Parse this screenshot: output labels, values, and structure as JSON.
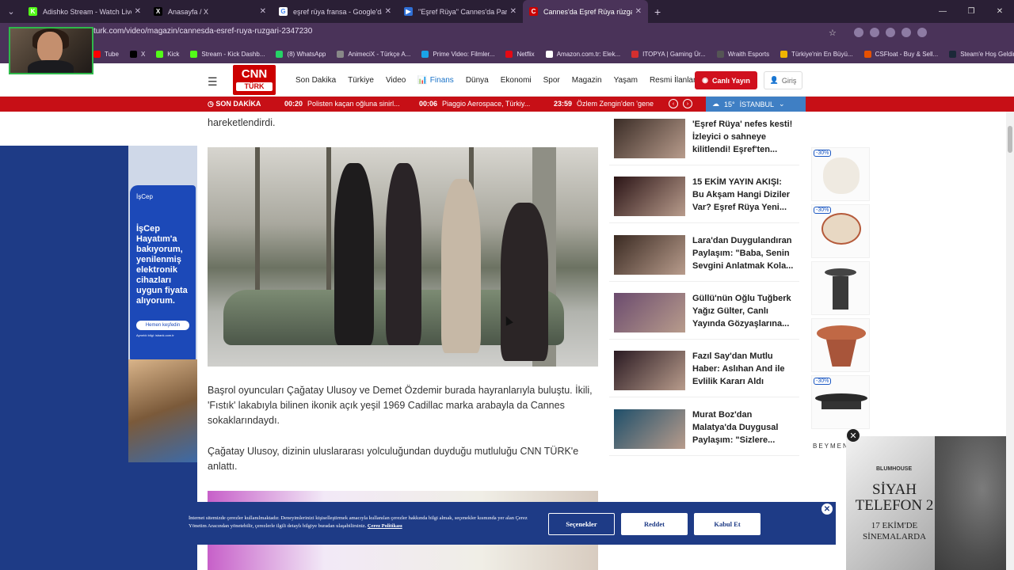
{
  "browser": {
    "tabs": [
      {
        "label": "Adishko Stream - Watch Live on",
        "color": "#53fc18",
        "glyph": "K"
      },
      {
        "label": "Anasayfa / X",
        "color": "#000000",
        "glyph": "X"
      },
      {
        "label": "eşref rüya fransa - Google'da A",
        "color": "#ffffff",
        "glyph": "G"
      },
      {
        "label": "\"Eşref Rüya\" Cannes'da Parladı",
        "color": "#2f6fd6",
        "glyph": "▶"
      },
      {
        "label": "Cannes'da Eşref Rüya rüzgarı",
        "color": "#cc0000",
        "glyph": "C"
      }
    ],
    "url": "turk.com/video/magazin/cannesda-esref-ruya-ruzgari-2347230",
    "bookmarks": [
      {
        "label": "Tube",
        "color": "#ff0000"
      },
      {
        "label": "X",
        "color": "#000000"
      },
      {
        "label": "Kick",
        "color": "#53fc18"
      },
      {
        "label": "Stream - Kick Dashb...",
        "color": "#53fc18"
      },
      {
        "label": "(8) WhatsApp",
        "color": "#25d366"
      },
      {
        "label": "AnimeciX - Türkçe A...",
        "color": "#888888"
      },
      {
        "label": "Prime Video: Filmler...",
        "color": "#1aa3e8"
      },
      {
        "label": "Netflix",
        "color": "#e50914"
      },
      {
        "label": "Amazon.com.tr: Elek...",
        "color": "#ffffff"
      },
      {
        "label": "ITOPYA | Gaming Ür...",
        "color": "#d32f2f"
      },
      {
        "label": "Wraith Esports",
        "color": "#555555"
      },
      {
        "label": "Türkiye'nin En Büyü...",
        "color": "#f0b400"
      },
      {
        "label": "CSFloat - Buy & Sell...",
        "color": "#e65100"
      },
      {
        "label": "Steam'e Hoş Geldiniz",
        "color": "#1b2838"
      }
    ]
  },
  "site": {
    "logo": {
      "top": "CNN",
      "bottom": "TÜRK"
    },
    "nav": [
      "Son Dakika",
      "Türkiye",
      "Video",
      "Finans",
      "Dünya",
      "Ekonomi",
      "Spor",
      "Magazin",
      "Yaşam",
      "Resmi İlanlar"
    ],
    "live_label": "Canlı Yayın",
    "login_label": "Giriş",
    "breaking": {
      "label": "SON DAKİKA",
      "items": [
        {
          "time": "00:20",
          "text": "Polisten kaçan oğluna sinirl..."
        },
        {
          "time": "00:06",
          "text": "Piaggio Aerospace, Türkiy..."
        },
        {
          "time": "23:59",
          "text": "Özlem Zengin'den 'gene"
        }
      ]
    },
    "weather": {
      "temp": "15°",
      "city": "İSTANBUL"
    }
  },
  "article": {
    "lead_tail": "hareketlendirdi.",
    "para1": "Başrol oyuncuları Çağatay Ulusoy ve Demet Özdemir burada hayranlarıyla buluştu. İkili, 'Fıstık' lakabıyla bilinen ikonik açık yeşil 1969 Cadillac marka arabayla da Cannes sokaklarındaydı.",
    "para2": "Çağatay Ulusoy, dizinin uluslararası yolculuğundan duyduğu mutluluğu CNN TÜRK'e anlattı."
  },
  "sidebar_news": [
    {
      "title": "'Eşref Rüya' nefes kesti! İzleyici o sahneye kilitlendi! Eşref'ten...",
      "color": "#3a2c26"
    },
    {
      "title": "15 EKİM YAYIN AKIŞI: Bu Akşam Hangi Diziler Var? Eşref Rüya Yeni...",
      "color": "#2b1416"
    },
    {
      "title": "Lara'dan Duygulandıran Paylaşım: \"Baba, Senin Sevgini Anlatmak Kola...",
      "color": "#3a2a22"
    },
    {
      "title": "Güllü'nün Oğlu Tuğberk Yağız Gülter, Canlı Yayında Gözyaşlarına...",
      "color": "#6b4b6e"
    },
    {
      "title": "Fazıl Say'dan Mutlu Haber: Aslıhan And ile Evlilik Kararı Aldı",
      "color": "#2a1a22"
    },
    {
      "title": "Murat Boz'dan Malatya'da Duygusal Paylaşım: \"Sizlere...",
      "color": "#1f4f6a"
    }
  ],
  "ads": {
    "isbank": {
      "brand": "İşCep",
      "copy": "İşCep Hayatım'a bakıyorum, yenilenmiş elektronik cihazları uygun fiyata alıyorum.",
      "cta": "Hemen keşfedin",
      "small": "Ayrıntılı bilgi: isbank.com.tr"
    },
    "beymen": {
      "discount": "-30%",
      "brand": "BEYMEN"
    },
    "movie": {
      "studio": "BLUMHOUSE",
      "title": "SİYAH TELEFON 2",
      "date": "17 EKİM'DE SİNEMALARDA"
    }
  },
  "cookie": {
    "text": "İnternet sitemizde çerezler kullanılmaktadır. Deneyimlerinizi kişiselleştirmek amacıyla kullanılan çerezler hakkında bilgi almak, seçenekler kısmında yer alan Çerez Yönetim Aracından yönetebilir, çerezlerle ilgili detaylı bilgiye buradan ulaşabilirsiniz.",
    "link": "Çerez Politikası",
    "options": "Seçenekler",
    "reject": "Reddet",
    "accept": "Kabul Et"
  }
}
